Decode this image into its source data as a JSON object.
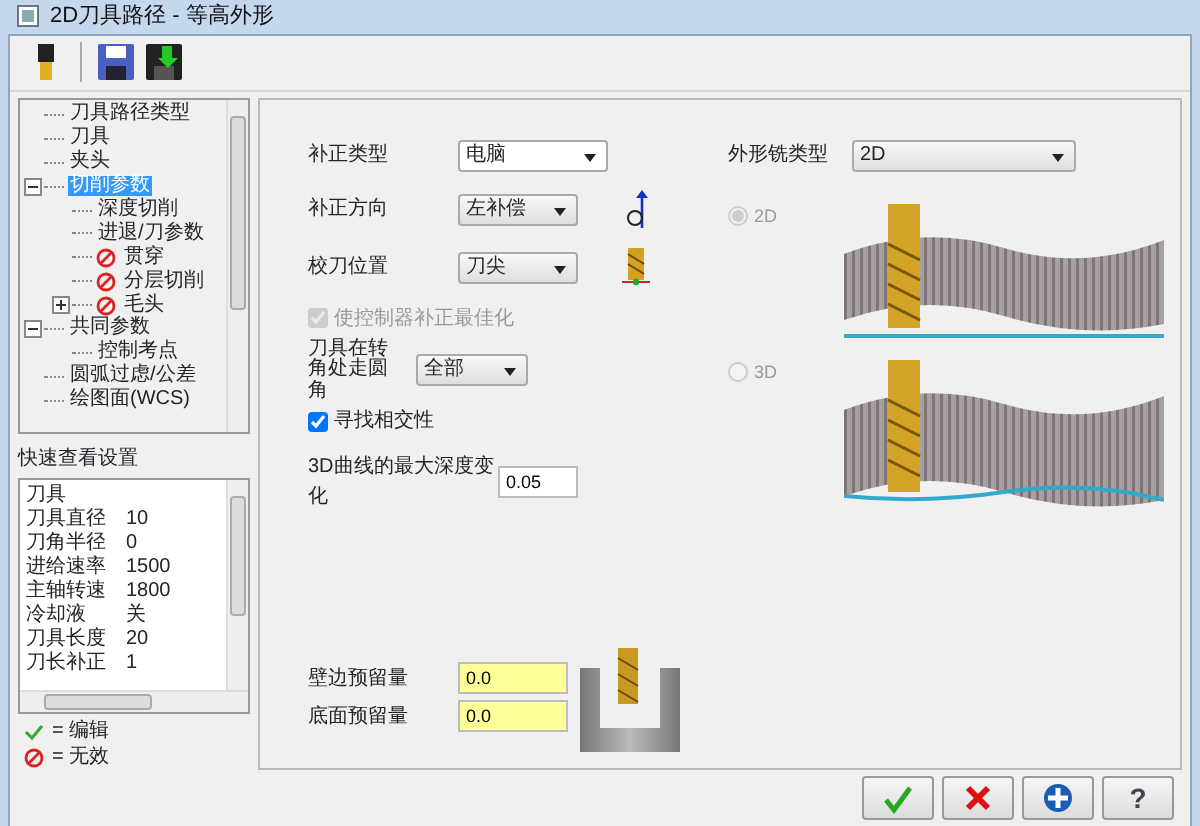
{
  "window": {
    "title": "2D刀具路径 - 等高外形"
  },
  "toolbar": [
    {
      "kind": "tool"
    },
    {
      "kind": "save"
    },
    {
      "kind": "save-apply"
    }
  ],
  "tree": {
    "items": [
      {
        "label": "刀具路径类型",
        "selected": false,
        "invalid": false
      },
      {
        "label": "刀具",
        "selected": false,
        "invalid": false
      },
      {
        "label": "夹头",
        "selected": false,
        "invalid": false
      },
      {
        "label": "切削参数",
        "selected": true,
        "invalid": false,
        "expanded": true,
        "children": [
          {
            "label": "深度切削",
            "selected": false,
            "invalid": false
          },
          {
            "label": "进退/刀参数",
            "selected": false,
            "invalid": false
          },
          {
            "label": "贯穿",
            "selected": false,
            "invalid": true
          },
          {
            "label": "分层切削",
            "selected": false,
            "invalid": true
          },
          {
            "label": "毛头",
            "selected": false,
            "invalid": true,
            "expanded": false
          }
        ]
      },
      {
        "label": "共同参数",
        "selected": false,
        "invalid": false,
        "expanded": true,
        "children": [
          {
            "label": "控制考点",
            "selected": false,
            "invalid": false
          }
        ]
      },
      {
        "label": "圆弧过虑/公差",
        "selected": false,
        "invalid": false
      },
      {
        "label": "绘图面(WCS)",
        "selected": false,
        "invalid": false
      }
    ]
  },
  "quick_view": {
    "title": "快速查看设置",
    "rows": [
      {
        "name": "刀具"
      },
      {
        "name": "刀具直径",
        "value": "10"
      },
      {
        "name": "刀角半径",
        "value": "0"
      },
      {
        "name": "进给速率",
        "value": "1500"
      },
      {
        "name": "主轴转速",
        "value": "1800"
      },
      {
        "name": "冷却液",
        "value": "关"
      },
      {
        "name": "刀具长度",
        "value": "20"
      },
      {
        "name": "刀长补正",
        "value": "1"
      }
    ]
  },
  "legend": [
    {
      "kind": "edit",
      "text": "= 编辑"
    },
    {
      "kind": "invalid",
      "text": "= 无效"
    }
  ],
  "form": {
    "compensation_type": {
      "label": "补正类型",
      "value": "电脑"
    },
    "compensation_direction": {
      "label": "补正方向",
      "value": "左补偿"
    },
    "tip_position": {
      "label": "校刀位置",
      "value": "刀尖"
    },
    "optimize": {
      "label": "使控制器补正最佳化",
      "checked": true,
      "disabled": true
    },
    "corner": {
      "label": "刀具在转角处走圆角",
      "value": "全部"
    },
    "find_intersection": {
      "label": "寻找相交性",
      "checked": true,
      "disabled": false
    },
    "max_depth": {
      "label": "3D曲线的最大深度变化",
      "value": "0.05"
    },
    "contour_type": {
      "label": "外形铣类型",
      "value": "2D"
    },
    "modes": [
      {
        "label": "2D",
        "selected": true,
        "disabled": true
      },
      {
        "label": "3D",
        "selected": false,
        "disabled": true
      }
    ],
    "wall_stock": {
      "label": "壁边预留量",
      "value": "0.0"
    },
    "floor_stock": {
      "label": "底面预留量",
      "value": "0.0"
    }
  },
  "buttons": [
    {
      "kind": "ok"
    },
    {
      "kind": "cancel"
    },
    {
      "kind": "add"
    },
    {
      "kind": "help",
      "label": "?"
    }
  ]
}
